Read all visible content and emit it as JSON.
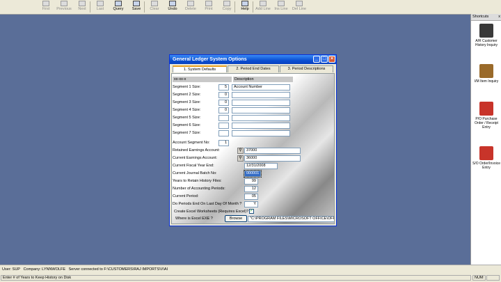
{
  "toolbar": {
    "buttons": [
      {
        "label": "First",
        "enabled": false,
        "icon": "first-record-icon"
      },
      {
        "label": "Previous",
        "enabled": false,
        "icon": "previous-record-icon"
      },
      {
        "label": "Next",
        "enabled": false,
        "icon": "next-record-icon"
      },
      {
        "label": "Last",
        "enabled": false,
        "icon": "last-record-icon"
      },
      {
        "label": "Query",
        "enabled": true,
        "icon": "query-icon"
      },
      {
        "label": "Save",
        "enabled": true,
        "icon": "save-icon"
      },
      {
        "label": "Clear",
        "enabled": false,
        "icon": "clear-icon"
      },
      {
        "label": "Undo",
        "enabled": true,
        "icon": "undo-icon"
      },
      {
        "label": "Delete",
        "enabled": false,
        "icon": "delete-icon"
      },
      {
        "label": "Print",
        "enabled": false,
        "icon": "print-icon"
      },
      {
        "label": "Copy",
        "enabled": false,
        "icon": "copy-icon"
      },
      {
        "label": "Help",
        "enabled": true,
        "icon": "help-icon"
      },
      {
        "label": "Add Line",
        "enabled": false,
        "icon": "add-line-icon"
      },
      {
        "label": "Ins Line",
        "enabled": false,
        "icon": "insert-line-icon"
      },
      {
        "label": "Del Line",
        "enabled": false,
        "icon": "delete-line-icon"
      }
    ]
  },
  "shortcuts": {
    "title": "Shortcuts",
    "close": "x",
    "items": [
      {
        "label": "A/R Customer History Inquiry",
        "icon": "customer-history-icon",
        "color": "#3a3a3a"
      },
      {
        "label": "I/M Item Inquiry",
        "icon": "item-inquiry-icon",
        "color": "#9a6a2a"
      },
      {
        "label": "P/O Purchase Order / Receipt Entry",
        "icon": "purchase-order-icon",
        "color": "#c8342a"
      },
      {
        "label": "S/O Order/Invoice Entry",
        "icon": "sales-order-icon",
        "color": "#c8342a"
      }
    ]
  },
  "dialog": {
    "title": "General Ledger System Options",
    "tabs": [
      {
        "label": "1. System Defaults",
        "active": true
      },
      {
        "label": "2. Period End Dates",
        "active": false
      },
      {
        "label": "3. Period Descriptions",
        "active": false
      }
    ],
    "grid_header_left": "xx-xx-x",
    "grid_header_right": "Description",
    "segments": [
      {
        "label": "Segment 1 Size:",
        "size": "5",
        "description": "Account Number"
      },
      {
        "label": "Segment 2 Size:",
        "size": "0",
        "description": ""
      },
      {
        "label": "Segment 3 Size:",
        "size": "0",
        "description": ""
      },
      {
        "label": "Segment 4 Size:",
        "size": "0",
        "description": ""
      },
      {
        "label": "Segment 5 Size:",
        "size": "",
        "description": ""
      },
      {
        "label": "Segment 6 Size:",
        "size": "",
        "description": ""
      },
      {
        "label": "Segment 7 Size:",
        "size": "",
        "description": ""
      }
    ],
    "account_segment_label": "Account Segment No:",
    "account_segment_value": "1",
    "retained_label": "Retained Earnings Account:",
    "retained_value": "37000",
    "current_earnings_label": "Current Earnings Account:",
    "current_earnings_value": "36000",
    "fiscal_year_end_label": "Current Fiscal Year End:",
    "fiscal_year_end_value": "12/31/2008",
    "journal_batch_label": "Current Journal Batch No:",
    "journal_batch_value": "000001",
    "years_history_label": "Years to Retain History Files:",
    "years_history_value": "99",
    "accounting_periods_label": "Number of Accounting Periods:",
    "accounting_periods_value": "12",
    "current_period_label": "Current Period:",
    "current_period_value": "05",
    "periods_end_label": "Do Periods End On Last Day Of Month ?",
    "periods_end_value": "Y",
    "excel_label": "Create Excel Worksheets (Requires Excel)?",
    "excel_checked": "✓",
    "excel_exe_label": "Where is Excel EXE ?",
    "browse_label": "Browse",
    "excel_path": "\"C:\\PROGRAM FILES\\MICROSOFT OFFICE\\OFFICE1"
  },
  "statusbar": {
    "user": "User: SUP",
    "company": "Company: LYNNWOLFE",
    "server": "Server connected to F:\\CUSTOMERS\\RAJ IMPORTS\\V\\AI",
    "hint": "Enter # of Years to Keep History on Disk",
    "num": "NUM"
  }
}
